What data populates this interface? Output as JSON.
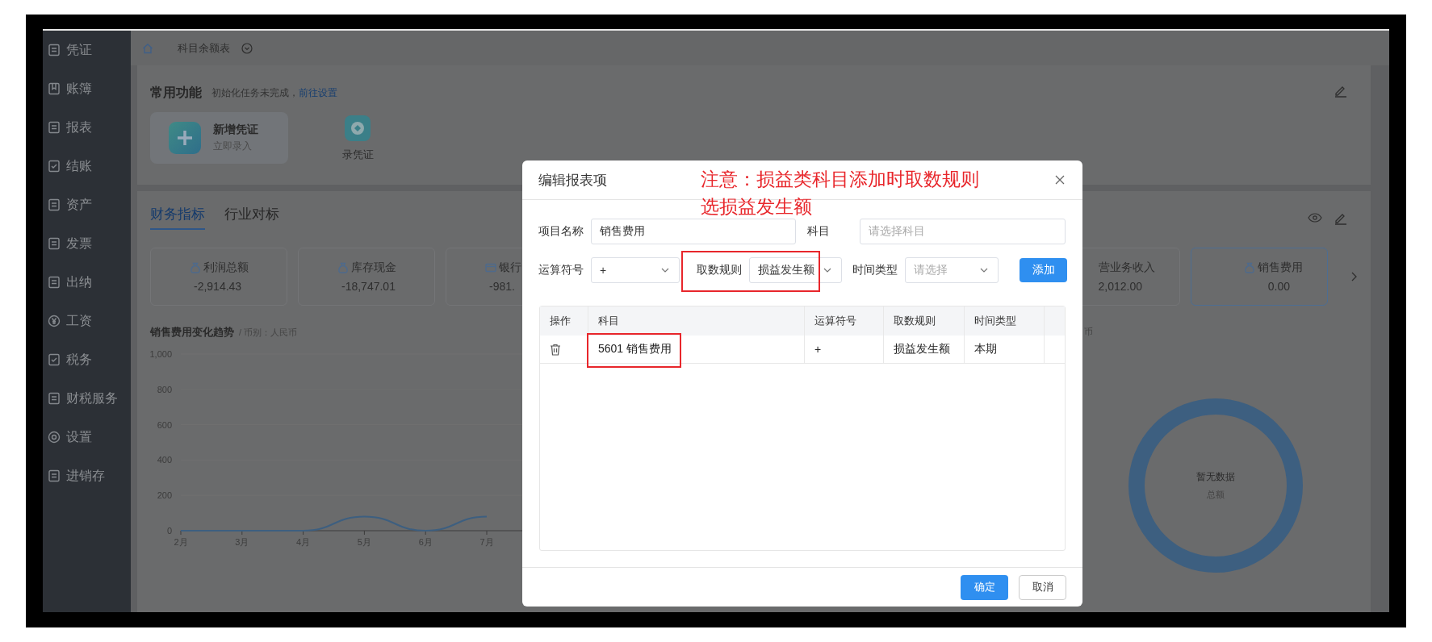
{
  "sidebar": {
    "items": [
      {
        "label": "凭证",
        "kind": "doc"
      },
      {
        "label": "账簿",
        "kind": "book"
      },
      {
        "label": "报表",
        "kind": "doc"
      },
      {
        "label": "结账",
        "kind": "check"
      },
      {
        "label": "资产",
        "kind": "doc"
      },
      {
        "label": "发票",
        "kind": "doc"
      },
      {
        "label": "出纳",
        "kind": "doc"
      },
      {
        "label": "工资",
        "kind": "yen"
      },
      {
        "label": "税务",
        "kind": "check"
      },
      {
        "label": "财税服务",
        "kind": "doc"
      },
      {
        "label": "设置",
        "kind": "gear"
      },
      {
        "label": "进销存",
        "kind": "doc"
      }
    ]
  },
  "top_bar": {
    "tabs": [
      {
        "label": "科目余额表"
      }
    ]
  },
  "quick_panel": {
    "title": "常用功能",
    "notice": "初始化任务未完成，",
    "link": "前往设置",
    "shortcuts": [
      {
        "kind": "tile",
        "title": "新增凭证",
        "subtitle": "立即录入"
      },
      {
        "kind": "icon",
        "title": "录凭证"
      }
    ]
  },
  "indicator_panel": {
    "tabs": [
      {
        "label": "财务指标",
        "selected": true
      },
      {
        "label": "行业对标",
        "selected": false
      }
    ],
    "cards_left": [
      {
        "label": "利润总额",
        "value": "-2,914.43",
        "selected": false
      },
      {
        "label": "库存现金",
        "value": "-18,747.01",
        "selected": false
      },
      {
        "label": "银行",
        "value": "-981.",
        "selected": false
      }
    ],
    "cards_right": [
      {
        "label": "营业务收入",
        "value": "2,012.00",
        "selected": false
      },
      {
        "label": "销售费用",
        "value": "0.00",
        "selected": true
      }
    ],
    "trend_chart": {
      "title": "销售费用变化趋势",
      "subtitle": "/ 币别：人民币",
      "chart_data": {
        "type": "line",
        "categories": [
          "2月",
          "3月",
          "4月",
          "5月",
          "6月",
          "7月"
        ],
        "series": [
          {
            "color": "#3d5f80",
            "values": [
              0,
              0,
              0,
              80,
              0,
              80
            ]
          }
        ],
        "ylim": [
          0,
          1000
        ],
        "yticks": [
          0,
          200,
          400,
          600,
          800,
          {
            "value": 1000,
            "label": "1,000"
          }
        ]
      }
    },
    "total_panel": {
      "title": "币",
      "empty_text": "暂无数据",
      "label": "总额"
    }
  },
  "dialog": {
    "title": "编辑报表项",
    "annotation": [
      "注意：损益类科目添加时取数规则",
      "选损益发生额"
    ],
    "form_rows": [
      [
        {
          "label": "项目名称",
          "kind": "input",
          "value": "销售费用"
        },
        {
          "label": "科目",
          "kind": "input",
          "placeholder": "请选择科目"
        }
      ],
      [
        {
          "label": "运算符号",
          "kind": "select",
          "value": "+"
        },
        {
          "label": "取数规则",
          "kind": "select",
          "value": "损益发生额",
          "highlighted": true
        },
        {
          "label": "时间类型",
          "kind": "select",
          "placeholder": "请选择"
        }
      ]
    ],
    "add_button": "添加",
    "table": {
      "columns": [
        "操作",
        "科目",
        "运算符号",
        "取数规则",
        "时间类型"
      ],
      "rows": [
        {
          "subject": "5601 销售费用",
          "subject_highlighted": true,
          "operator": "+",
          "rule": "损益发生额",
          "period": "本期"
        }
      ]
    },
    "buttons": [
      {
        "label": "确定",
        "kind": "primary"
      },
      {
        "label": "取消",
        "kind": "default"
      }
    ]
  }
}
